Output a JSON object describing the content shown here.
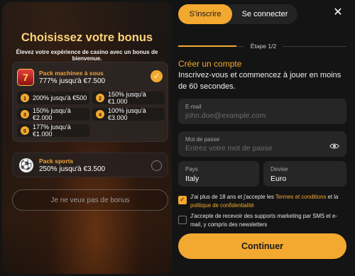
{
  "bonus_panel": {
    "title": "Choisissez votre bonus",
    "subtitle": "Élevez votre expérience de casino avec un bonus de bienvenue.",
    "casino_pack": {
      "name": "Pack machines à sous",
      "amount": "777% jusqu'à €7.500",
      "icon": "slot-machine-icon",
      "selected": true,
      "tiers": [
        {
          "num": "1",
          "text": "200% jusqu'à €500"
        },
        {
          "num": "2",
          "text": "150% jusqu'à €1.000"
        },
        {
          "num": "3",
          "text": "150% jusqu'à €2.000"
        },
        {
          "num": "4",
          "text": "100% jusqu'à €3.000"
        },
        {
          "num": "5",
          "text": "177% jusqu'à €1.000"
        }
      ]
    },
    "sports_pack": {
      "name": "Pack sports",
      "amount": "250% jusqu'à €3.500",
      "icon": "soccer-ball-icon",
      "selected": false
    },
    "no_bonus_label": "Je ne veux pas de bonus"
  },
  "auth": {
    "tabs": [
      {
        "label": "S'inscrire",
        "active": true
      },
      {
        "label": "Se connecter",
        "active": false
      }
    ],
    "close_icon": "close-icon",
    "step_label": "Étape 1/2",
    "title": "Créer un compte",
    "description": "Inscrivez-vous et commencez à jouer en moins de 60 secondes.",
    "email": {
      "label": "E-mail",
      "placeholder": "john.doe@example.com",
      "value": ""
    },
    "password": {
      "label": "Mot de passe",
      "placeholder": "Entrez votre mot de passe",
      "value": ""
    },
    "country": {
      "label": "Pays",
      "value": "Italy"
    },
    "currency": {
      "label": "Devise",
      "value": "Euro"
    },
    "terms": {
      "checked": true,
      "prefix": "J'ai plus de 18 ans et j'accepte les ",
      "terms_link": "Termes et conditions",
      "middle": " et la ",
      "privacy_link": "politique de confidentialité"
    },
    "marketing": {
      "checked": false,
      "text": "J'accepte de recevoir des supports marketing par SMS et e-mail, y compris des newsletters"
    },
    "submit_label": "Continuer"
  },
  "colors": {
    "accent": "#f3a92f",
    "gold_title": "#ffd37a",
    "background": "#141414"
  }
}
